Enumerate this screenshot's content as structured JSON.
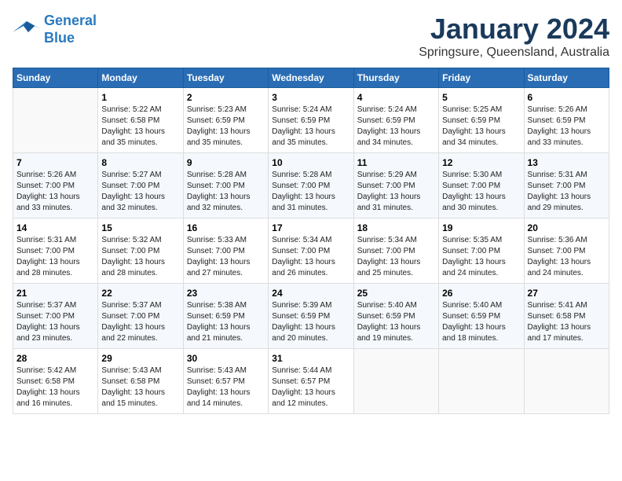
{
  "header": {
    "logo_line1": "General",
    "logo_line2": "Blue",
    "month": "January 2024",
    "location": "Springsure, Queensland, Australia"
  },
  "weekdays": [
    "Sunday",
    "Monday",
    "Tuesday",
    "Wednesday",
    "Thursday",
    "Friday",
    "Saturday"
  ],
  "weeks": [
    [
      {
        "day": "",
        "sunrise": "",
        "sunset": "",
        "daylight": ""
      },
      {
        "day": "1",
        "sunrise": "Sunrise: 5:22 AM",
        "sunset": "Sunset: 6:58 PM",
        "daylight": "Daylight: 13 hours and 35 minutes."
      },
      {
        "day": "2",
        "sunrise": "Sunrise: 5:23 AM",
        "sunset": "Sunset: 6:59 PM",
        "daylight": "Daylight: 13 hours and 35 minutes."
      },
      {
        "day": "3",
        "sunrise": "Sunrise: 5:24 AM",
        "sunset": "Sunset: 6:59 PM",
        "daylight": "Daylight: 13 hours and 35 minutes."
      },
      {
        "day": "4",
        "sunrise": "Sunrise: 5:24 AM",
        "sunset": "Sunset: 6:59 PM",
        "daylight": "Daylight: 13 hours and 34 minutes."
      },
      {
        "day": "5",
        "sunrise": "Sunrise: 5:25 AM",
        "sunset": "Sunset: 6:59 PM",
        "daylight": "Daylight: 13 hours and 34 minutes."
      },
      {
        "day": "6",
        "sunrise": "Sunrise: 5:26 AM",
        "sunset": "Sunset: 6:59 PM",
        "daylight": "Daylight: 13 hours and 33 minutes."
      }
    ],
    [
      {
        "day": "7",
        "sunrise": "Sunrise: 5:26 AM",
        "sunset": "Sunset: 7:00 PM",
        "daylight": "Daylight: 13 hours and 33 minutes."
      },
      {
        "day": "8",
        "sunrise": "Sunrise: 5:27 AM",
        "sunset": "Sunset: 7:00 PM",
        "daylight": "Daylight: 13 hours and 32 minutes."
      },
      {
        "day": "9",
        "sunrise": "Sunrise: 5:28 AM",
        "sunset": "Sunset: 7:00 PM",
        "daylight": "Daylight: 13 hours and 32 minutes."
      },
      {
        "day": "10",
        "sunrise": "Sunrise: 5:28 AM",
        "sunset": "Sunset: 7:00 PM",
        "daylight": "Daylight: 13 hours and 31 minutes."
      },
      {
        "day": "11",
        "sunrise": "Sunrise: 5:29 AM",
        "sunset": "Sunset: 7:00 PM",
        "daylight": "Daylight: 13 hours and 31 minutes."
      },
      {
        "day": "12",
        "sunrise": "Sunrise: 5:30 AM",
        "sunset": "Sunset: 7:00 PM",
        "daylight": "Daylight: 13 hours and 30 minutes."
      },
      {
        "day": "13",
        "sunrise": "Sunrise: 5:31 AM",
        "sunset": "Sunset: 7:00 PM",
        "daylight": "Daylight: 13 hours and 29 minutes."
      }
    ],
    [
      {
        "day": "14",
        "sunrise": "Sunrise: 5:31 AM",
        "sunset": "Sunset: 7:00 PM",
        "daylight": "Daylight: 13 hours and 28 minutes."
      },
      {
        "day": "15",
        "sunrise": "Sunrise: 5:32 AM",
        "sunset": "Sunset: 7:00 PM",
        "daylight": "Daylight: 13 hours and 28 minutes."
      },
      {
        "day": "16",
        "sunrise": "Sunrise: 5:33 AM",
        "sunset": "Sunset: 7:00 PM",
        "daylight": "Daylight: 13 hours and 27 minutes."
      },
      {
        "day": "17",
        "sunrise": "Sunrise: 5:34 AM",
        "sunset": "Sunset: 7:00 PM",
        "daylight": "Daylight: 13 hours and 26 minutes."
      },
      {
        "day": "18",
        "sunrise": "Sunrise: 5:34 AM",
        "sunset": "Sunset: 7:00 PM",
        "daylight": "Daylight: 13 hours and 25 minutes."
      },
      {
        "day": "19",
        "sunrise": "Sunrise: 5:35 AM",
        "sunset": "Sunset: 7:00 PM",
        "daylight": "Daylight: 13 hours and 24 minutes."
      },
      {
        "day": "20",
        "sunrise": "Sunrise: 5:36 AM",
        "sunset": "Sunset: 7:00 PM",
        "daylight": "Daylight: 13 hours and 24 minutes."
      }
    ],
    [
      {
        "day": "21",
        "sunrise": "Sunrise: 5:37 AM",
        "sunset": "Sunset: 7:00 PM",
        "daylight": "Daylight: 13 hours and 23 minutes."
      },
      {
        "day": "22",
        "sunrise": "Sunrise: 5:37 AM",
        "sunset": "Sunset: 7:00 PM",
        "daylight": "Daylight: 13 hours and 22 minutes."
      },
      {
        "day": "23",
        "sunrise": "Sunrise: 5:38 AM",
        "sunset": "Sunset: 6:59 PM",
        "daylight": "Daylight: 13 hours and 21 minutes."
      },
      {
        "day": "24",
        "sunrise": "Sunrise: 5:39 AM",
        "sunset": "Sunset: 6:59 PM",
        "daylight": "Daylight: 13 hours and 20 minutes."
      },
      {
        "day": "25",
        "sunrise": "Sunrise: 5:40 AM",
        "sunset": "Sunset: 6:59 PM",
        "daylight": "Daylight: 13 hours and 19 minutes."
      },
      {
        "day": "26",
        "sunrise": "Sunrise: 5:40 AM",
        "sunset": "Sunset: 6:59 PM",
        "daylight": "Daylight: 13 hours and 18 minutes."
      },
      {
        "day": "27",
        "sunrise": "Sunrise: 5:41 AM",
        "sunset": "Sunset: 6:58 PM",
        "daylight": "Daylight: 13 hours and 17 minutes."
      }
    ],
    [
      {
        "day": "28",
        "sunrise": "Sunrise: 5:42 AM",
        "sunset": "Sunset: 6:58 PM",
        "daylight": "Daylight: 13 hours and 16 minutes."
      },
      {
        "day": "29",
        "sunrise": "Sunrise: 5:43 AM",
        "sunset": "Sunset: 6:58 PM",
        "daylight": "Daylight: 13 hours and 15 minutes."
      },
      {
        "day": "30",
        "sunrise": "Sunrise: 5:43 AM",
        "sunset": "Sunset: 6:57 PM",
        "daylight": "Daylight: 13 hours and 14 minutes."
      },
      {
        "day": "31",
        "sunrise": "Sunrise: 5:44 AM",
        "sunset": "Sunset: 6:57 PM",
        "daylight": "Daylight: 13 hours and 12 minutes."
      },
      {
        "day": "",
        "sunrise": "",
        "sunset": "",
        "daylight": ""
      },
      {
        "day": "",
        "sunrise": "",
        "sunset": "",
        "daylight": ""
      },
      {
        "day": "",
        "sunrise": "",
        "sunset": "",
        "daylight": ""
      }
    ]
  ]
}
